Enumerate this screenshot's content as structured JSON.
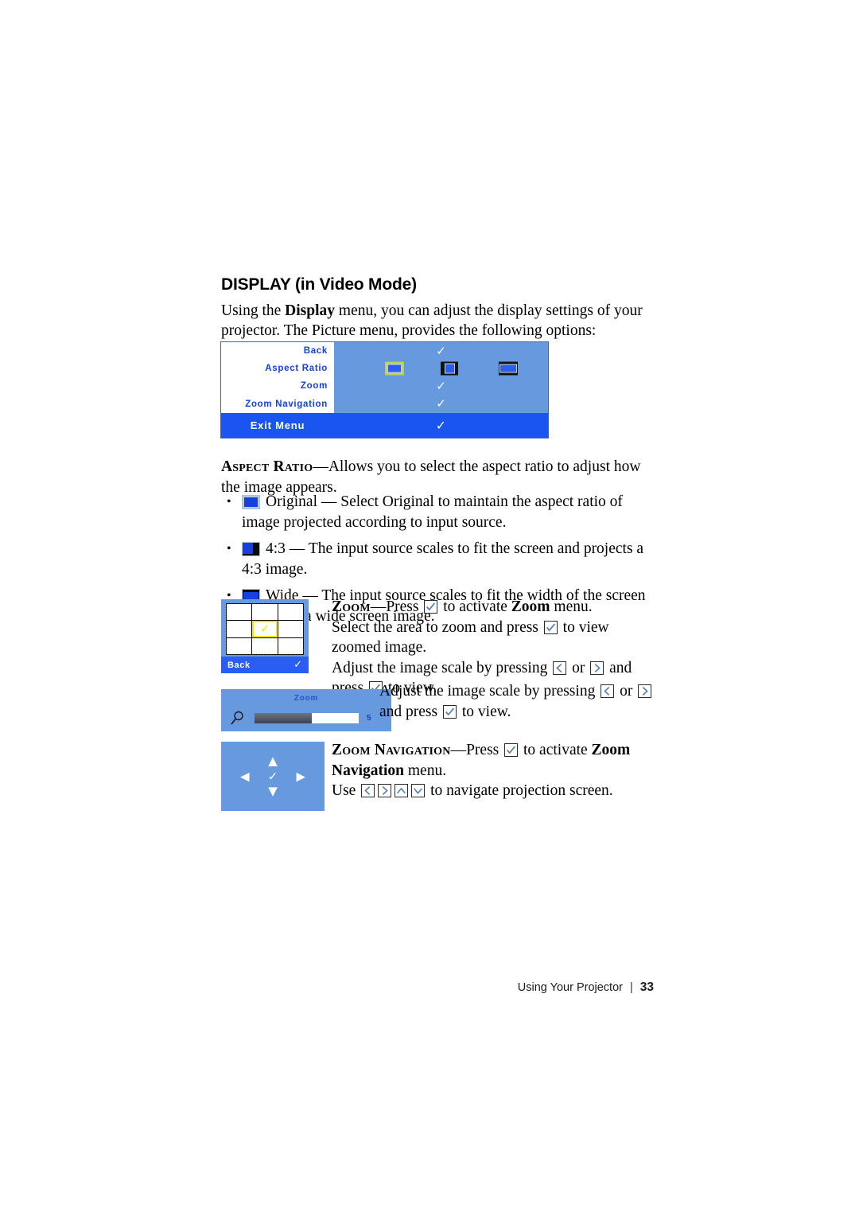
{
  "page": {
    "heading": "DISPLAY (in Video Mode)",
    "intro_before_bold": "Using the ",
    "intro_bold": "Display",
    "intro_after_bold": " menu, you can adjust the display settings of your projector. The Picture menu, provides the following options:"
  },
  "osd_menu": {
    "rows": [
      {
        "label": "Back",
        "value_icon": "check-icon",
        "check": "✓"
      },
      {
        "label": "Aspect Ratio",
        "value_icon": "aspect-ratio-icons"
      },
      {
        "label": "Zoom",
        "value_icon": "check-icon",
        "check": "✓"
      },
      {
        "label": "Zoom Navigation",
        "value_icon": "check-icon",
        "check": "✓"
      }
    ],
    "exit": {
      "label": "Exit Menu",
      "check": "✓"
    },
    "aspect_icons": [
      {
        "name": "original",
        "selected": true
      },
      {
        "name": "four-three",
        "selected": false
      },
      {
        "name": "wide",
        "selected": false
      }
    ],
    "colors": {
      "panel_bg": "#6699dd",
      "label_bg": "#ffffff",
      "label_text": "#1540d8",
      "exit_bg": "#1a55f0",
      "selection_highlight": "#b9d44a"
    }
  },
  "aspect_ratio_section": {
    "term": "Aspect Ratio",
    "dash": "—",
    "description": "Allows you to select the aspect ratio to adjust how the image appears.",
    "bullets": [
      {
        "icon": "aspect-original-icon",
        "text": "Original — Select Original to maintain the aspect ratio of image projected according to input source."
      },
      {
        "icon": "aspect-43-icon",
        "text": "4:3 — The input source scales to fit the screen and projects a 4:3 image."
      },
      {
        "icon": "aspect-wide-icon",
        "text": "Wide — The input source scales to fit the width of the screen to project a wide screen image."
      }
    ]
  },
  "zoom_section": {
    "term": "Zoom",
    "dash": "—",
    "line1_a": "Press ",
    "line1_b": " to activate ",
    "line1_bold": "Zoom",
    "line1_c": " menu.",
    "line2_a": "Select the area to zoom and press ",
    "line2_b": " to view zoomed image.",
    "line3_a": "Adjust the image scale by pressing ",
    "line3_or": " or ",
    "line3_b": " and press ",
    "line3_c": " to view.",
    "grid_panel": {
      "back_label": "Back",
      "back_check": "✓",
      "selected_cell_index": 4,
      "selected_check": "✓",
      "cell_count": 9
    }
  },
  "zoom_slider_section": {
    "line_a": "Adjust the image scale by pressing ",
    "line_or": " or ",
    "line_b": " and press ",
    "line_c": " to view.",
    "panel": {
      "title": "Zoom",
      "value": "5",
      "fill_percent": 55,
      "magnifier_icon": "magnifier-icon"
    }
  },
  "zoom_navigation_section": {
    "term": "Zoom Navigation",
    "dash": "—",
    "line1_a": "Press ",
    "line1_b": " to activate ",
    "line1_bold": "Zoom Navigation",
    "line1_c": " menu.",
    "line2_a": "Use ",
    "line2_b": " to navigate projection screen.",
    "panel": {
      "up": "▲",
      "down": "▼",
      "left": "◀",
      "right": "▶",
      "ok": "✓"
    }
  },
  "footer": {
    "title": "Using Your Projector",
    "separator": "|",
    "page_number": "33"
  }
}
